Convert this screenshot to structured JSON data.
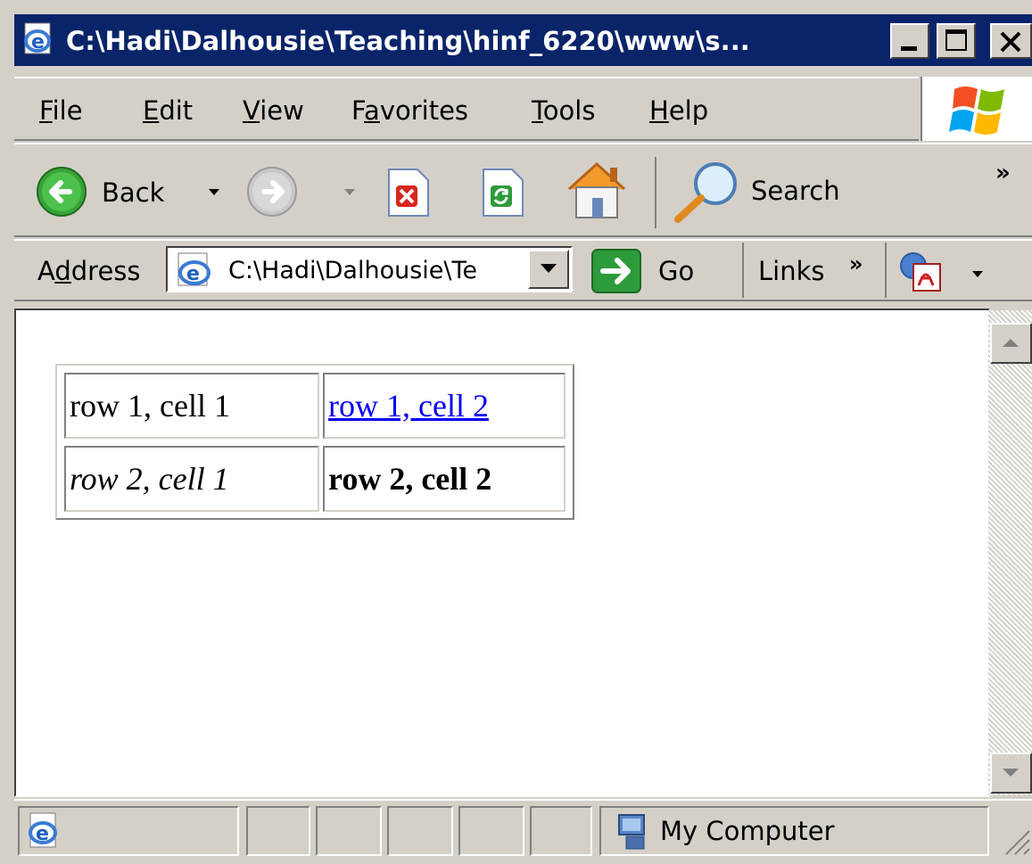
{
  "window": {
    "title": "C:\\Hadi\\Dalhousie\\Teaching\\hinf_6220\\www\\s...",
    "caption_buttons": {
      "minimize": "_",
      "maximize": "☐",
      "close": "X"
    }
  },
  "menu": {
    "items": [
      {
        "label": "File",
        "accel": "F",
        "rest": "ile"
      },
      {
        "label": "Edit",
        "accel": "E",
        "rest": "dit"
      },
      {
        "label": "View",
        "accel": "V",
        "rest": "iew"
      },
      {
        "label": "Favorites",
        "pre": "F",
        "accel": "a",
        "rest": "vorites"
      },
      {
        "label": "Tools",
        "accel": "T",
        "rest": "ools"
      },
      {
        "label": "Help",
        "accel": "H",
        "rest": "elp"
      }
    ]
  },
  "toolbar": {
    "back_label": "Back",
    "search_label": "Search",
    "overflow": "»"
  },
  "addressbar": {
    "label_pre": "A",
    "label_accel": "d",
    "label_rest": "dress",
    "value": "C:\\Hadi\\Dalhousie\\Te",
    "go_label": "Go",
    "links_label": "Links",
    "links_overflow": "»"
  },
  "table": {
    "rows": [
      [
        "row 1, cell 1",
        "row 1, cell 2"
      ],
      [
        "row 2, cell 1",
        "row 2, cell 2"
      ]
    ]
  },
  "statusbar": {
    "zone": "My Computer"
  },
  "icons": {
    "title": "ie-page-icon",
    "back": "back-arrow-icon",
    "forward": "forward-arrow-icon",
    "stop": "stop-icon",
    "refresh": "refresh-icon",
    "home": "home-icon",
    "search": "magnifier-icon",
    "go": "go-arrow-icon",
    "pdf": "pdf-icon",
    "windows_logo": "windows-logo-icon",
    "my_computer": "my-computer-icon"
  },
  "colors": {
    "titlebar": "#0a246a",
    "chrome": "#d4d0c8",
    "link": "#0000ee"
  }
}
